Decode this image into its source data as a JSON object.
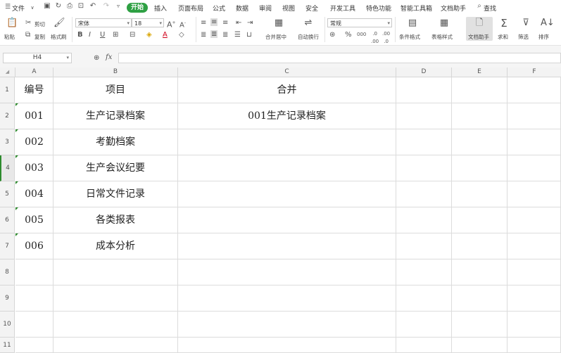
{
  "menu": {
    "file_label": "文件",
    "tabs": [
      "开始",
      "插入",
      "页面布局",
      "公式",
      "数据",
      "审阅",
      "视图",
      "安全",
      "开发工具",
      "特色功能",
      "智能工具箱",
      "文档助手"
    ],
    "search_label": "查找"
  },
  "toolbar": {
    "paste": "粘贴",
    "cut": "剪切",
    "copy": "复制",
    "format_painter": "格式刷",
    "font_name": "宋体",
    "font_size": "18",
    "number_format": "常规",
    "merge_center": "合并居中",
    "wrap_text": "自动换行",
    "conditional_format": "条件格式",
    "table_style": "表格样式",
    "doc_helper": "文档助手",
    "sum": "求和",
    "filter": "筛选",
    "sort": "排序"
  },
  "formula_bar": {
    "cell_ref": "H4",
    "fx_label": "fx",
    "value": ""
  },
  "sheet": {
    "columns": [
      "A",
      "B",
      "C",
      "D",
      "E",
      "F"
    ],
    "row_numbers": [
      "1",
      "2",
      "3",
      "4",
      "5",
      "6",
      "7",
      "8",
      "9",
      "10",
      "11"
    ],
    "rows": [
      [
        "编号",
        "项目",
        "合并"
      ],
      [
        "001",
        "生产记录档案",
        "001生产记录档案"
      ],
      [
        "002",
        "考勤档案",
        ""
      ],
      [
        "003",
        "生产会议纪要",
        ""
      ],
      [
        "004",
        "日常文件记录",
        ""
      ],
      [
        "005",
        "各类报表",
        ""
      ],
      [
        "006",
        "成本分析",
        ""
      ]
    ]
  },
  "colors": {
    "accent": "#2ea043",
    "grid_line": "#dcdcdc",
    "header_bg": "#f3f3f3"
  }
}
